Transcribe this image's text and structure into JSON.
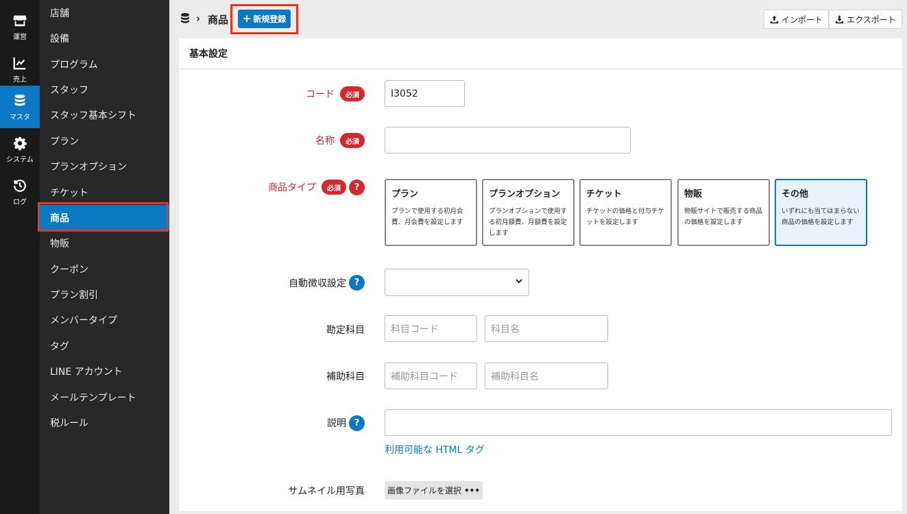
{
  "rail": [
    {
      "label": "運営",
      "icon": "store-icon"
    },
    {
      "label": "売上",
      "icon": "chart-line-icon"
    },
    {
      "label": "マスタ",
      "icon": "database-icon",
      "active": true
    },
    {
      "label": "システム",
      "icon": "gear-icon"
    },
    {
      "label": "ログ",
      "icon": "history-icon"
    }
  ],
  "subnav": [
    {
      "label": "店舗"
    },
    {
      "label": "設備"
    },
    {
      "label": "プログラム"
    },
    {
      "label": "スタッフ"
    },
    {
      "label": "スタッフ基本シフト"
    },
    {
      "label": "プラン"
    },
    {
      "label": "プランオプション"
    },
    {
      "label": "チケット"
    },
    {
      "label": "商品",
      "active": true
    },
    {
      "label": "物販"
    },
    {
      "label": "クーポン"
    },
    {
      "label": "プラン割引"
    },
    {
      "label": "メンバータイプ"
    },
    {
      "label": "タグ"
    },
    {
      "label": "LINE アカウント"
    },
    {
      "label": "メールテンプレート"
    },
    {
      "label": "税ルール"
    }
  ],
  "header": {
    "breadcrumb_sep": "›",
    "title": "商品",
    "new_label": "新規登録",
    "import_label": "インポート",
    "export_label": "エクスポート"
  },
  "panel": {
    "title": "基本設定",
    "required_badge": "必須",
    "code": {
      "label": "コード",
      "value": "I3052"
    },
    "name": {
      "label": "名称",
      "value": ""
    },
    "type": {
      "label": "商品タイプ",
      "selected": "その他",
      "options": [
        {
          "title": "プラン",
          "desc": "プランで使用する初月会費、月会費を設定します"
        },
        {
          "title": "プランオプション",
          "desc": "プランオプションで使用する初月額費、月額費を設定します"
        },
        {
          "title": "チケット",
          "desc": "チケットの価格と付与チケットを設定します"
        },
        {
          "title": "物販",
          "desc": "物販サイトで販売する商品の価格を設定します"
        },
        {
          "title": "その他",
          "desc": "いずれにも当てはまらない商品の価格を設定します"
        }
      ]
    },
    "auto_collect": {
      "label": "自動徴収設定",
      "value": ""
    },
    "account": {
      "label": "勘定科目",
      "code_placeholder": "科目コード",
      "name_placeholder": "科目名"
    },
    "sub_account": {
      "label": "補助科目",
      "code_placeholder": "補助科目コード",
      "name_placeholder": "補助科目名"
    },
    "description": {
      "label": "説明",
      "value": "",
      "link": "利用可能な HTML タグ"
    },
    "thumbnail": {
      "label": "サムネイル用写真",
      "button": "画像ファイルを選択"
    }
  },
  "colors": {
    "accent": "#0a78c2",
    "required": "#d6262e",
    "highlight": "#e8351e"
  }
}
